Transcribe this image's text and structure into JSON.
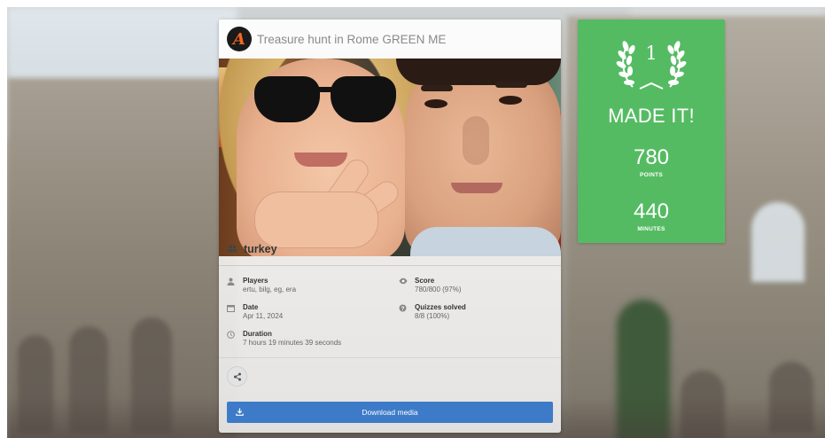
{
  "hunt": {
    "title": "Treasure hunt in Rome GREEN ME",
    "logo_letter": "A"
  },
  "team": {
    "icon": "users-icon",
    "name": "turkey"
  },
  "details": {
    "players_label": "Players",
    "players_value": "ertu, bilg, eg, era",
    "date_label": "Date",
    "date_value": "Apr 11, 2024",
    "duration_label": "Duration",
    "duration_value": "7 hours 19 minutes 39 seconds",
    "score_label": "Score",
    "score_value": "780/800 (97%)",
    "quizzes_label": "Quizzes solved",
    "quizzes_value": "8/8 (100%)"
  },
  "actions": {
    "share_icon": "share-icon",
    "download_label": "Download media",
    "download_icon": "download-icon"
  },
  "result": {
    "rank": "1",
    "headline": "MADE IT!",
    "points_value": "780",
    "points_label": "POINTS",
    "minutes_value": "440",
    "minutes_label": "MINUTES"
  },
  "colors": {
    "result_green": "#55bb63",
    "button_blue": "#3d7bc8",
    "logo_orange": "#f26722"
  }
}
